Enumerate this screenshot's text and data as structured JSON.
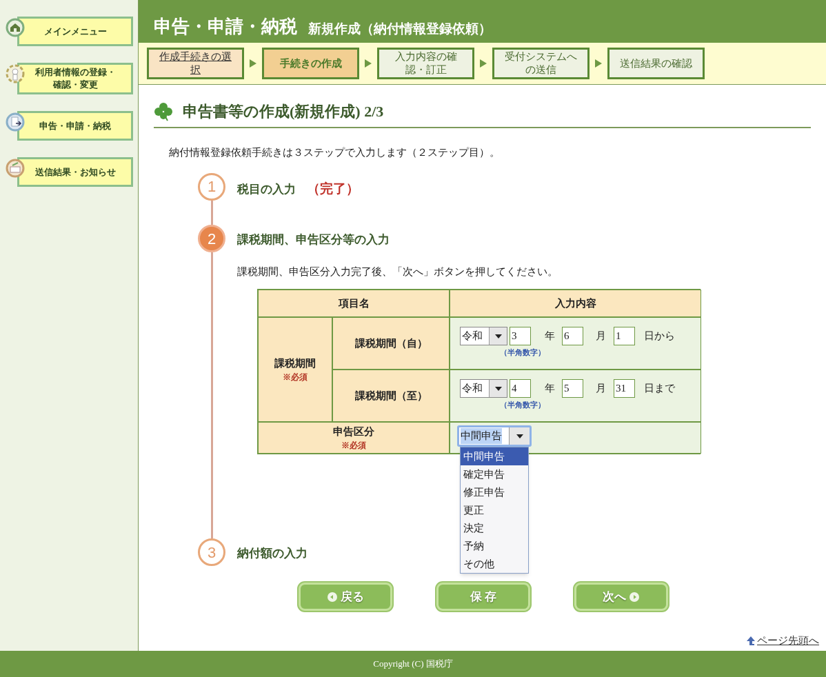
{
  "sidebar": {
    "items": [
      {
        "label": "メインメニュー",
        "kind": "home"
      },
      {
        "label": "利用者情報の登録・確認・変更",
        "kind": "user"
      },
      {
        "label": "申告・申請・納税",
        "kind": "file"
      },
      {
        "label": "送信結果・お知らせ",
        "kind": "mail"
      }
    ]
  },
  "header": {
    "title": "申告・申請・納税",
    "subtitle": "新規作成（納付情報登録依頼）"
  },
  "steps": [
    {
      "label": "作成手続きの選択",
      "kind": "done",
      "selected": false
    },
    {
      "label": "手続きの作成",
      "kind": "current",
      "selected": true
    },
    {
      "label": "入力内容の確認・訂正",
      "kind": "todo",
      "selected": false
    },
    {
      "label": "受付システムへの送信",
      "kind": "todo",
      "selected": false
    },
    {
      "label": "送信結果の確認",
      "kind": "todo",
      "selected": false
    }
  ],
  "heading": "申告書等の作成(新規作成) 2/3",
  "intro": "納付情報登録依頼手続きは３ステップで入力します（２ステップ目）。",
  "progress": [
    {
      "number": "1",
      "label": "税目の入力",
      "status": "（完了）",
      "selected": false
    },
    {
      "number": "2",
      "label": "課税期間、申告区分等の入力",
      "selected": true,
      "instruction": "課税期間、申告区分入力完了後、「次へ」ボタンを押してください。"
    },
    {
      "number": "3",
      "label": "納付額の入力",
      "selected": false
    }
  ],
  "table": {
    "columns": [
      "項目名",
      "入力内容"
    ],
    "group": {
      "label": "課税期間",
      "required": "※必須"
    },
    "period_rows": [
      {
        "label": "課税期間（自）",
        "era": "令和",
        "year": "3",
        "year_unit": "年",
        "month": "6",
        "month_unit": "月",
        "day": "1",
        "suffix": "日から",
        "hint": "（半角数字）"
      },
      {
        "label": "課税期間（至）",
        "era": "令和",
        "year": "4",
        "year_unit": "年",
        "month": "5",
        "month_unit": "月",
        "day": "31",
        "suffix": "日まで",
        "hint": "（半角数字）"
      }
    ],
    "category": {
      "label": "申告区分",
      "required": "※必須",
      "value": "中間申告",
      "expanded": true,
      "options": [
        {
          "label": "中間申告",
          "selected": true
        },
        {
          "label": "確定申告",
          "selected": false
        },
        {
          "label": "修正申告",
          "selected": false
        },
        {
          "label": "更正",
          "selected": false
        },
        {
          "label": "決定",
          "selected": false
        },
        {
          "label": "予納",
          "selected": false
        },
        {
          "label": "その他",
          "selected": false
        }
      ]
    }
  },
  "buttons": [
    {
      "label": "戻る",
      "kind": "back"
    },
    {
      "label": "保 存",
      "kind": "save"
    },
    {
      "label": "次へ",
      "kind": "next"
    }
  ],
  "page_top": "ページ先頭へ",
  "footer": "Copyright (C) 国税庁"
}
